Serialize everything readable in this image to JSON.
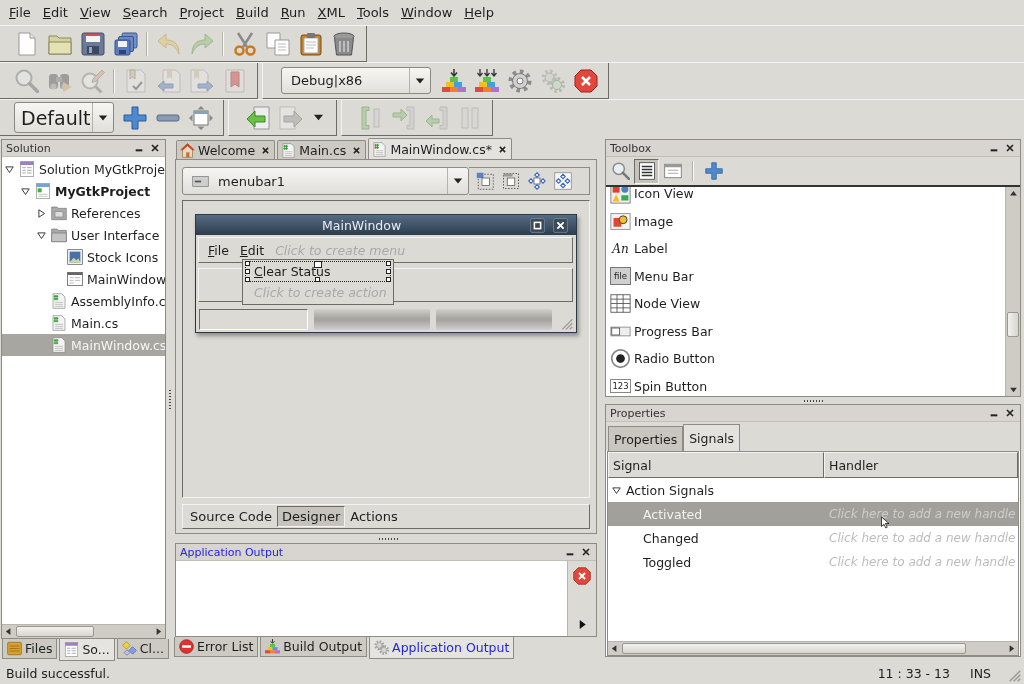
{
  "menu_bar": [
    "File",
    "Edit",
    "View",
    "Search",
    "Project",
    "Build",
    "Run",
    "XML",
    "Tools",
    "Window",
    "Help"
  ],
  "toolbar_rows": [
    [
      [
        {
          "kind": "new",
          "disabled": false
        },
        {
          "kind": "open",
          "disabled": false
        },
        {
          "kind": "save",
          "disabled": false
        },
        {
          "kind": "save-all",
          "disabled": false
        },
        {
          "kind": "separator"
        },
        {
          "kind": "undo",
          "disabled": true
        },
        {
          "kind": "redo",
          "disabled": true
        },
        {
          "kind": "separator"
        },
        {
          "kind": "cut",
          "disabled": false
        },
        {
          "kind": "copy",
          "disabled": false
        },
        {
          "kind": "paste",
          "disabled": false
        },
        {
          "kind": "delete",
          "disabled": false
        }
      ]
    ],
    [
      [
        {
          "kind": "find",
          "disabled": true
        },
        {
          "kind": "find-files",
          "disabled": true
        },
        {
          "kind": "replace",
          "disabled": true
        },
        {
          "kind": "separator"
        },
        {
          "kind": "bookmark",
          "disabled": true
        },
        {
          "kind": "bookmark-prev",
          "disabled": true
        },
        {
          "kind": "bookmark-next",
          "disabled": true
        },
        {
          "kind": "bookmark-clear",
          "disabled": true
        }
      ],
      [
        {
          "kind": "combo",
          "value": "Debug|x86"
        },
        {
          "kind": "build",
          "disabled": false
        },
        {
          "kind": "rebuild",
          "disabled": false
        },
        {
          "kind": "run",
          "disabled": false
        },
        {
          "kind": "debug",
          "disabled": true
        },
        {
          "kind": "stop",
          "disabled": false
        }
      ]
    ],
    [
      [
        {
          "kind": "layout-combo",
          "value": "Default"
        },
        {
          "kind": "add",
          "disabled": false
        },
        {
          "kind": "remove",
          "disabled": false
        },
        {
          "kind": "fit",
          "disabled": false
        }
      ],
      [
        {
          "kind": "back",
          "disabled": false
        },
        {
          "kind": "forward",
          "disabled": true
        },
        {
          "kind": "dropdown"
        }
      ],
      [
        {
          "kind": "step-over",
          "disabled": true
        },
        {
          "kind": "step-into",
          "disabled": true
        },
        {
          "kind": "step-out",
          "disabled": true
        },
        {
          "kind": "pause",
          "disabled": true
        }
      ]
    ]
  ],
  "solution_pad": {
    "title": "Solution",
    "focused": false,
    "tree": [
      {
        "label": "Solution MyGtkProje",
        "kind": "solution",
        "expanded": true,
        "selected": false,
        "children": [
          {
            "label": "MyGtkProject",
            "kind": "project",
            "expanded": true,
            "selected": false,
            "children": [
              {
                "label": "References",
                "kind": "references",
                "expanded": false,
                "selected": false
              },
              {
                "label": "User Interface",
                "kind": "folder",
                "expanded": true,
                "selected": false,
                "children": [
                  {
                    "label": "Stock Icons",
                    "kind": "stock-icons",
                    "selected": false
                  },
                  {
                    "label": "MainWindow",
                    "kind": "window",
                    "selected": false
                  }
                ]
              },
              {
                "label": "AssemblyInfo.c",
                "kind": "cs-file",
                "selected": false
              },
              {
                "label": "Main.cs",
                "kind": "cs-file",
                "selected": false
              },
              {
                "label": "MainWindow.cs",
                "kind": "cs-file",
                "selected": true
              }
            ]
          }
        ]
      }
    ],
    "tabs": [
      {
        "label": "Files",
        "kind": "files",
        "selected": false
      },
      {
        "label": "So...",
        "kind": "solution",
        "selected": true
      },
      {
        "label": "Cl...",
        "kind": "classes",
        "selected": false
      }
    ]
  },
  "document_tabs": [
    {
      "label": "Welcome",
      "kind": "welcome",
      "selected": false
    },
    {
      "label": "Main.cs",
      "kind": "cs-file",
      "selected": false
    },
    {
      "label": "MainWindow.cs*",
      "kind": "cs-file",
      "selected": true
    }
  ],
  "designer": {
    "widget_selector": "menubar1",
    "preview_window": {
      "title": "MainWindow",
      "menu_bar": {
        "items": [
          "File",
          "Edit"
        ],
        "placeholder": "Click to create menu"
      },
      "popup_menu": {
        "items": [
          {
            "label": "Clear Status",
            "selected": true
          }
        ],
        "placeholder": "Click to create action"
      }
    },
    "tabs": [
      {
        "label": "Source Code",
        "selected": false
      },
      {
        "label": "Designer",
        "selected": true
      },
      {
        "label": "Actions",
        "selected": false
      }
    ]
  },
  "output_pad": {
    "title": "Application Output",
    "focused": true,
    "tabs": [
      {
        "label": "Error List",
        "kind": "errors",
        "selected": false
      },
      {
        "label": "Build Output",
        "kind": "build",
        "selected": false
      },
      {
        "label": "Application Output",
        "kind": "output",
        "selected": true
      }
    ]
  },
  "toolbox": {
    "title": "Toolbox",
    "focused": false,
    "tools": [
      {
        "kind": "search",
        "selected": false
      },
      {
        "kind": "list",
        "selected": true
      },
      {
        "kind": "compact",
        "selected": false
      },
      {
        "kind": "separator"
      },
      {
        "kind": "add",
        "selected": false
      }
    ],
    "items": [
      {
        "label": "Icon View",
        "kind": "icon-view"
      },
      {
        "label": "Image",
        "kind": "image"
      },
      {
        "label": "Label",
        "kind": "label",
        "icon_text": "An"
      },
      {
        "label": "Menu Bar",
        "kind": "menu-bar",
        "icon_text": "file"
      },
      {
        "label": "Node View",
        "kind": "node-view"
      },
      {
        "label": "Progress Bar",
        "kind": "progress-bar"
      },
      {
        "label": "Radio Button",
        "kind": "radio-button"
      },
      {
        "label": "Spin Button",
        "kind": "spin-button",
        "icon_text": "123"
      }
    ]
  },
  "properties_pad": {
    "title": "Properties",
    "focused": false,
    "tabs": [
      {
        "label": "Properties",
        "selected": false
      },
      {
        "label": "Signals",
        "selected": true
      }
    ],
    "columns": [
      "Signal",
      "Handler"
    ],
    "groups": [
      {
        "label": "Action Signals",
        "expanded": true,
        "signals": [
          {
            "name": "Activated",
            "placeholder": "Click here to add a new handle",
            "selected": true
          },
          {
            "name": "Changed",
            "placeholder": "Click here to add a new handle",
            "selected": false
          },
          {
            "name": "Toggled",
            "placeholder": "Click here to add a new handle",
            "selected": false
          }
        ]
      }
    ]
  },
  "status_bar": {
    "message": "Build successful.",
    "position": "11 : 33 - 13",
    "mode": "INS"
  }
}
